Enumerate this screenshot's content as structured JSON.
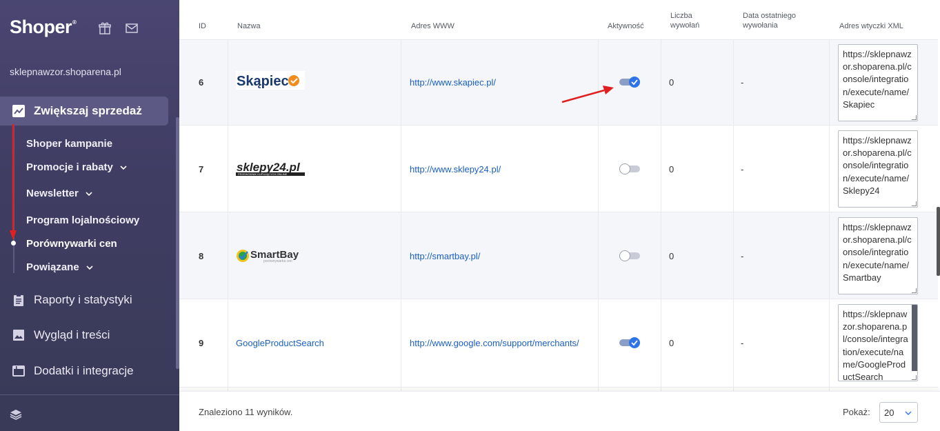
{
  "sidebar": {
    "logo": "Shoper",
    "logo_mark": "®",
    "shop_name": "sklepnawzor.shoparena.pl",
    "active_section": "Zwiększaj sprzedaż",
    "subitems": [
      {
        "label": "Shoper kampanie"
      },
      {
        "label": "Promocje i rabaty"
      },
      {
        "label": "Newsletter"
      },
      {
        "label": "Program lojalnościowy"
      },
      {
        "label": "Porównywarki cen"
      },
      {
        "label": "Powiązane"
      }
    ],
    "sections": [
      {
        "label": "Raporty i statystyki",
        "icon": "clipboard-icon"
      },
      {
        "label": "Wygląd i treści",
        "icon": "image-icon"
      },
      {
        "label": "Dodatki i integracje",
        "icon": "window-icon"
      }
    ]
  },
  "table": {
    "headers": {
      "id": "ID",
      "name": "Nazwa",
      "www": "Adres WWW",
      "active": "Aktywność",
      "calls_1": "Liczba",
      "calls_2": "wywołań",
      "last_1": "Data ostatniego",
      "last_2": "wywołania",
      "xml": "Adres wtyczki XML"
    },
    "rows": [
      {
        "id": "6",
        "name": "Skąpiec",
        "name_type": "logo",
        "url": "http://www.skapiec.pl/",
        "active": true,
        "calls": "0",
        "last": "-",
        "xml": "https://sklepnawzor.shoparena.pl/console/integration/execute/name/Skapiec"
      },
      {
        "id": "7",
        "name": "sklepy24.pl",
        "name_type": "logo",
        "logo_sub": "PRZEWODNIK KUPUJĄCYCH ONLINE",
        "url": "http://www.sklepy24.pl/",
        "active": false,
        "calls": "0",
        "last": "-",
        "xml": "https://sklepnawzor.shoparena.pl/console/integration/execute/name/Sklepy24"
      },
      {
        "id": "8",
        "name": "SmartBay",
        "name_type": "logo",
        "logo_sub": "porównywarka cen",
        "url": "http://smartbay.pl/",
        "active": false,
        "calls": "0",
        "last": "-",
        "xml": "https://sklepnawzor.shoparena.pl/console/integration/execute/name/Smartbay"
      },
      {
        "id": "9",
        "name": "GoogleProductSearch",
        "name_type": "link",
        "url": "http://www.google.com/support/merchants/",
        "active": true,
        "calls": "0",
        "last": "-",
        "xml": "https://sklepnawzor.shoparena.pl/console/integration/execute/name/GoogleProductSearch"
      }
    ]
  },
  "footer": {
    "found": "Znaleziono 11 wyników.",
    "show_label": "Pokaż:",
    "per_page": "20"
  },
  "colors": {
    "sidebar_bg": "#403d63",
    "active_item_bg": "#5c5985",
    "link": "#1a5fc2",
    "toggle_on": "#2e74e6",
    "annotation_arrow": "#e02020"
  }
}
